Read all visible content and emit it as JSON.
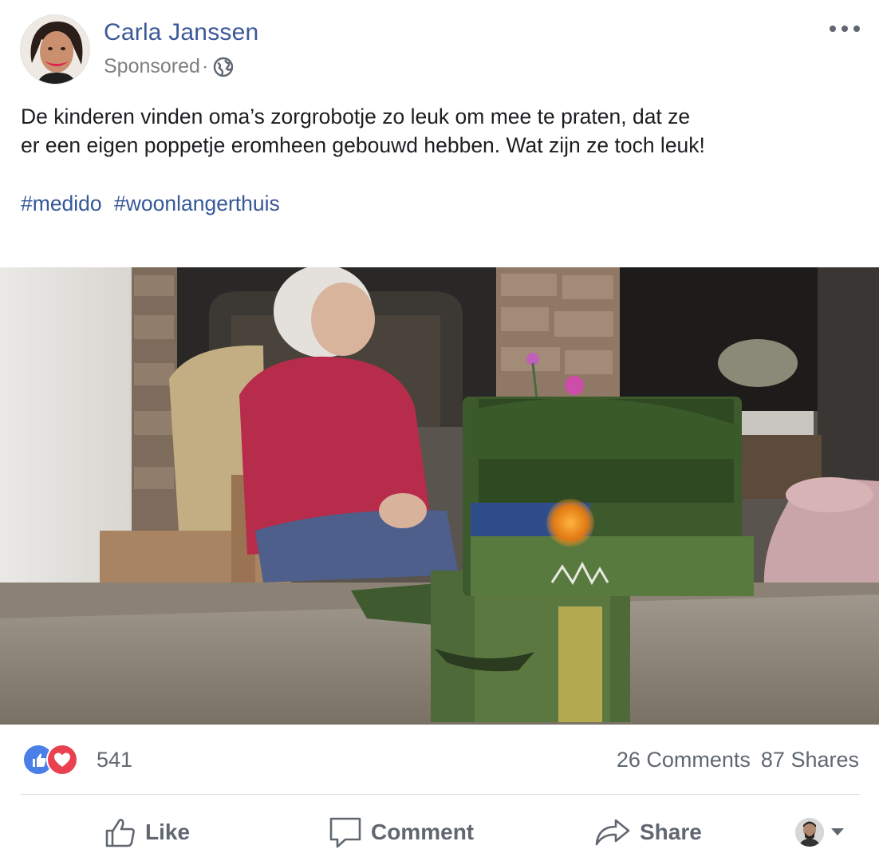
{
  "post": {
    "author": "Carla Janssen",
    "sponsored_label": "Sponsored",
    "meta_separator": "·",
    "visibility_icon": "globe-icon",
    "options_icon": "more-options-icon",
    "text_line1": "De kinderen vinden oma’s zorgrobotje zo leuk om mee te praten, dat ze",
    "text_line2": "er een eigen poppetje eromheen gebouwd hebben. Wat zijn ze toch leuk!",
    "hashtags": [
      "#medido",
      "#woonlangerthuis"
    ]
  },
  "stats": {
    "reactions": [
      "like-reaction-icon",
      "love-reaction-icon"
    ],
    "reaction_count": "541",
    "comments": "26 Comments",
    "shares": "87 Shares"
  },
  "actions": {
    "like": "Like",
    "comment": "Comment",
    "share": "Share"
  },
  "colors": {
    "link_blue": "#3b5998",
    "text": "#1c1e21",
    "muted": "#606770",
    "like_blue": "#4a7fe8",
    "love_red": "#e9414f"
  }
}
